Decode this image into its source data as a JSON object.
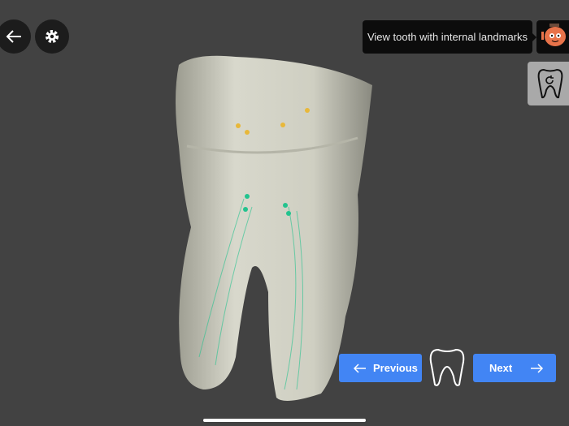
{
  "header": {
    "back_icon": "arrow-left-icon",
    "settings_icon": "gear-icon"
  },
  "tooltip": {
    "text": "View tooth with internal landmarks"
  },
  "reset_view": {
    "icon": "tooth-rotate-icon"
  },
  "navigation": {
    "previous_label": "Previous",
    "next_label": "Next",
    "accent": "#4285f4"
  },
  "landmarks": {
    "crown_color": "#e8b83a",
    "root_color": "#22c38e"
  }
}
